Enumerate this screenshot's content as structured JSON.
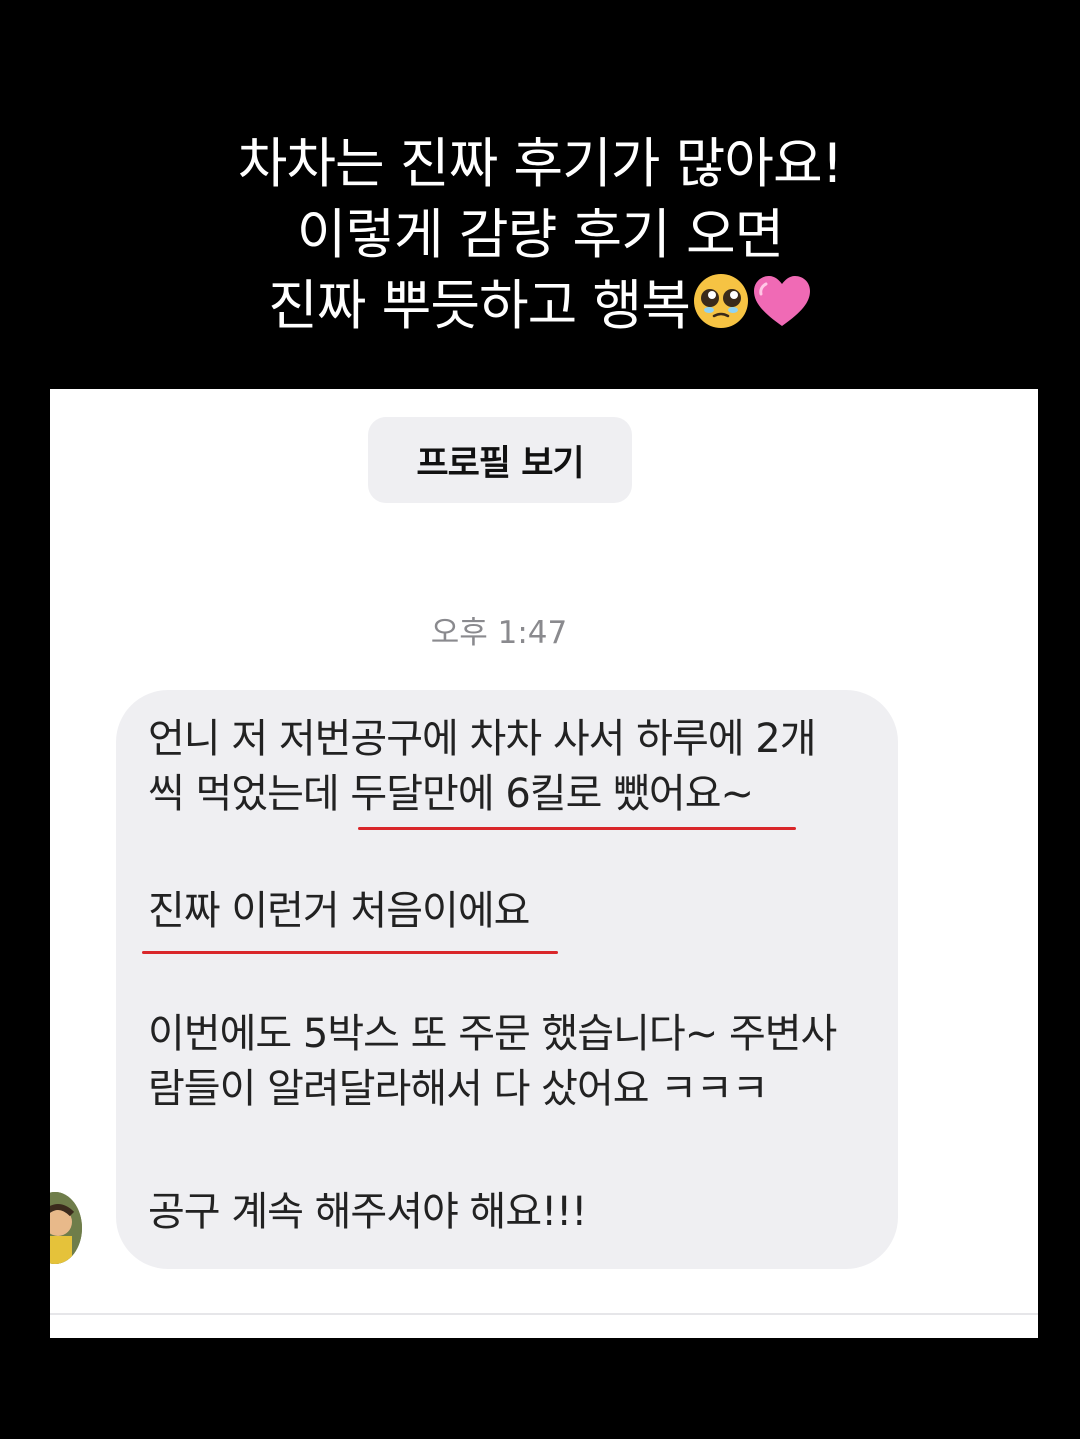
{
  "caption": {
    "lines": [
      "차차는 진짜 후기가 많아요!",
      "이렇게 감량 후기 오면",
      "진짜 뿌듯하고 행복"
    ],
    "emojis": [
      "pleading-face-emoji",
      "pink-heart-emoji"
    ]
  },
  "chat": {
    "profile_button": "프로필 보기",
    "timestamp": "오후 1:47",
    "message": {
      "p1_line1": "언니 저 저번공구에 차차 사서 하루에 2개",
      "p1_line2": "씩 먹었는데 두달만에 6킬로 뺐어요~",
      "p2": "진짜 이런거 처음이에요",
      "p3_line1": "이번에도 5박스 또 주문 했습니다~ 주변사",
      "p3_line2": "람들이 알려달라해서 다 샀어요 ㅋㅋㅋ",
      "p4": "공구 계속 해주셔야 해요!!!"
    },
    "highlight_color": "#d9262a"
  }
}
